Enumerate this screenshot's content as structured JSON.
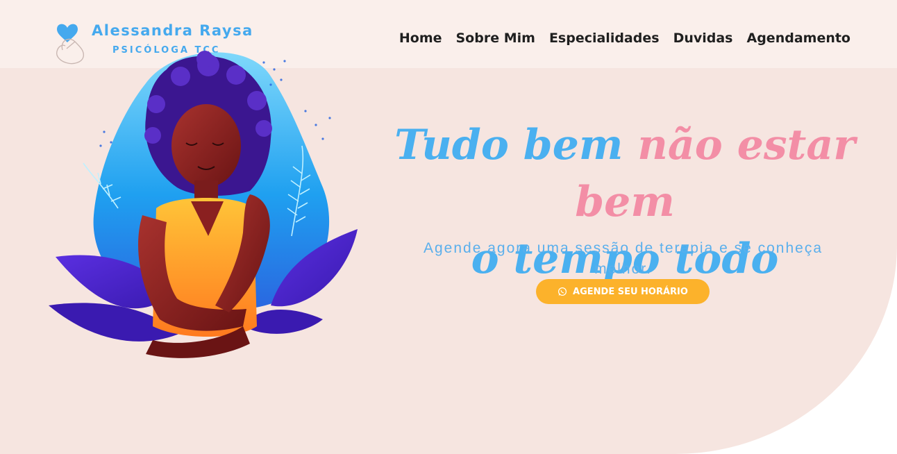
{
  "brand": {
    "name": "Alessandra Raysa",
    "subtitle": "PSICÓLOGA TCC",
    "logo_icon": "heart-hand-icon",
    "color": "#45a9ee"
  },
  "nav": {
    "items": [
      {
        "label": "Home"
      },
      {
        "label": "Sobre Mim"
      },
      {
        "label": "Especialidades"
      },
      {
        "label": "Duvidas"
      },
      {
        "label": "Agendamento"
      }
    ]
  },
  "hero": {
    "headline_part1": "Tudo bem",
    "headline_part2": "não estar bem",
    "headline_part3": "o tempo todo",
    "subtitle": "Agende agora uma sessão de terapia e se conheça melhor.",
    "cta_label": "AGENDE SEU HORÁRIO",
    "cta_icon": "whatsapp-icon",
    "illustration": "woman-self-hug-illustration"
  },
  "colors": {
    "background": "#f6e5e0",
    "headline_blue": "#4ab0f0",
    "headline_pink": "#f38ea6",
    "cta": "#fcb22b",
    "nav_text": "#1f1f1f"
  }
}
